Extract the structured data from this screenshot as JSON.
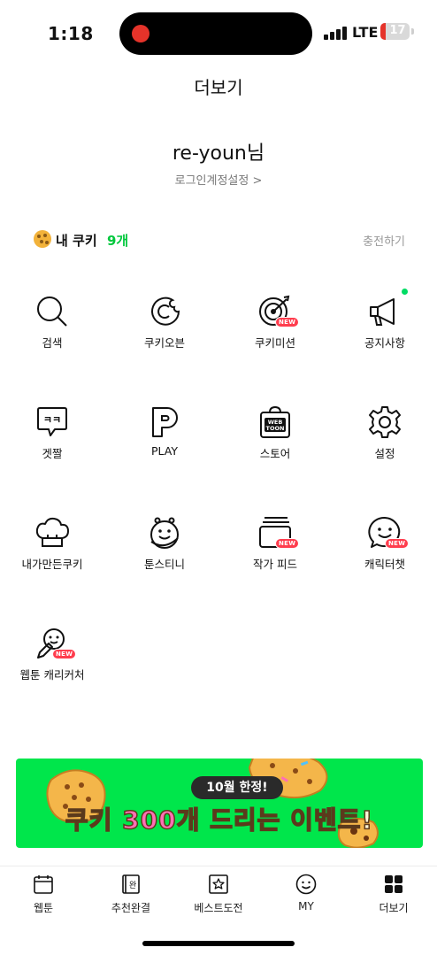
{
  "status_bar": {
    "time": "1:18",
    "network": "LTE",
    "battery": "17",
    "battery_level": 0.17,
    "battery_color": "#e5332a"
  },
  "header": {
    "title": "더보기"
  },
  "profile": {
    "name": "re-youn님",
    "login_settings": "로그인계정설정 >"
  },
  "cookie": {
    "label": "내 쿠키",
    "count": "9개",
    "charge": "충전하기",
    "accent": "#00c73c"
  },
  "menu": {
    "search": {
      "label": "검색",
      "icon": "search-icon"
    },
    "cookie_oven": {
      "label": "쿠키오븐",
      "icon": "cookie-oven-icon"
    },
    "cookie_mission": {
      "label": "쿠키미션",
      "icon": "target-icon",
      "badge": "NEW"
    },
    "notice": {
      "label": "공지사항",
      "icon": "megaphone-icon"
    },
    "getjjal": {
      "label": "겟짤",
      "icon": "getjjal-icon",
      "icon_text": "ㅋㅋ"
    },
    "play": {
      "label": "PLAY",
      "icon": "play-icon"
    },
    "store": {
      "label": "스토어",
      "icon": "store-bag-icon",
      "icon_text_1": "WEB",
      "icon_text_2": "TOON"
    },
    "settings": {
      "label": "설정",
      "icon": "gear-icon"
    },
    "my_cookie": {
      "label": "내가만든쿠키",
      "icon": "chef-hat-icon"
    },
    "toon_destiny": {
      "label": "툰스티니",
      "icon": "toon-destiny-icon"
    },
    "author_feed": {
      "label": "작가 피드",
      "icon": "feed-icon",
      "badge": "NEW"
    },
    "character_chat": {
      "label": "캐릭터챗",
      "icon": "chat-face-icon",
      "badge": "NEW"
    },
    "caricature": {
      "label": "웹툰 캐리커처",
      "icon": "caricature-icon",
      "badge": "NEW"
    }
  },
  "banner": {
    "tag": "10월 한정!",
    "text_prefix": "쿠키 ",
    "text_number": "300",
    "text_suffix": "개 드리는 이벤트!",
    "background": "#00e64b"
  },
  "tabbar": {
    "webtoon": {
      "label": "웹툰",
      "icon": "calendar-icon"
    },
    "recommended": {
      "label": "추천완결",
      "icon": "complete-book-icon",
      "icon_text": "완"
    },
    "best": {
      "label": "베스트도전",
      "icon": "star-box-icon"
    },
    "my": {
      "label": "MY",
      "icon": "smile-icon"
    },
    "more": {
      "label": "더보기",
      "icon": "grid-icon"
    }
  }
}
